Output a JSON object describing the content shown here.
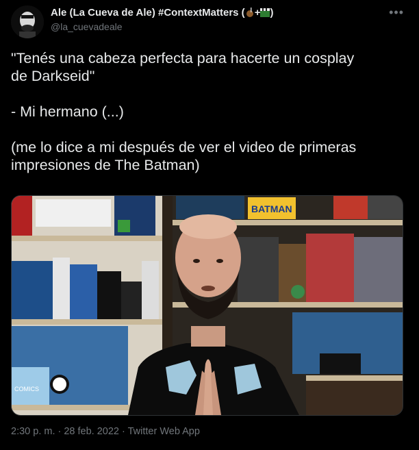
{
  "user": {
    "display_name": "Ale (La Cueva de Ale) #ContextMatters (",
    "display_name_suffix": ")",
    "handle": "@la_cuevadeale",
    "emoji": [
      "mate-icon",
      "plus",
      "clapper-board-icon"
    ]
  },
  "tweet": {
    "line1": "\"Tenés una cabeza perfecta para hacerte un cosplay",
    "line2": "de Darkseid\"",
    "line3": "- Mi hermano (...)",
    "line4": "(me lo dice a mi después de ver el video de primeras",
    "line5": "impresiones de The Batman)"
  },
  "media": {
    "description_icon": "video-frame-image",
    "batman_label": "BATMAN",
    "comics_label": "COMICS"
  },
  "meta": {
    "timestamp": "2:30 p. m. · 28 feb. 2022 · Twitter Web App"
  },
  "more_icon": "more-icon"
}
